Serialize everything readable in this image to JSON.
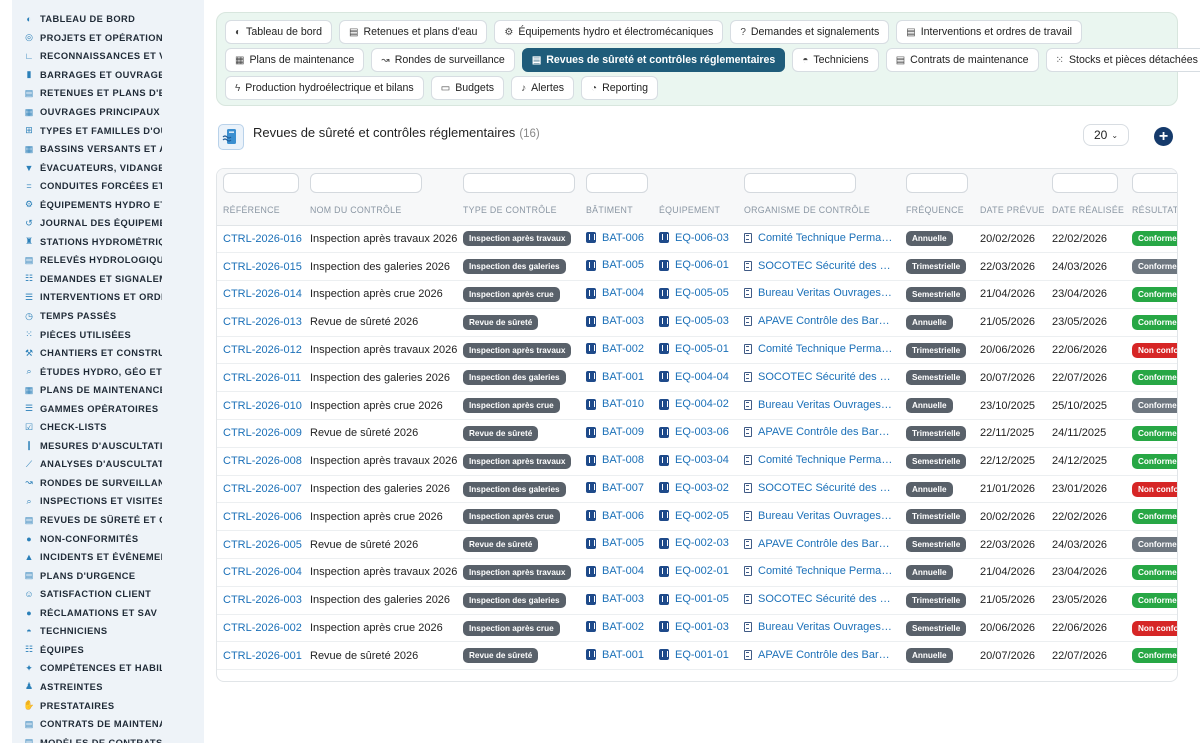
{
  "sidebar": {
    "items": [
      {
        "label": "TABLEAU DE BORD",
        "icon": "dashboard-icon",
        "glyph": "◐"
      },
      {
        "label": "PROJETS ET OPÉRATIONS",
        "icon": "target-icon",
        "glyph": "◎"
      },
      {
        "label": "RECONNAISSANCES ET VISITES",
        "icon": "ruler-icon",
        "glyph": "∟"
      },
      {
        "label": "BARRAGES ET OUVRAGES",
        "icon": "bars-icon",
        "glyph": "▮"
      },
      {
        "label": "RETENUES ET PLANS D'EAU",
        "icon": "document-icon",
        "glyph": "▤"
      },
      {
        "label": "OUVRAGES PRINCIPAUX",
        "icon": "building-icon",
        "glyph": "▦"
      },
      {
        "label": "TYPES ET FAMILLES D'OUVRAGES",
        "icon": "hierarchy-icon",
        "glyph": "⊞"
      },
      {
        "label": "BASSINS VERSANTS ET AFFLUENTS",
        "icon": "grid-icon",
        "glyph": "▦"
      },
      {
        "label": "ÉVACUATEURS, VIDANGES",
        "icon": "funnel-icon",
        "glyph": "▼"
      },
      {
        "label": "CONDUITES FORCÉES ET CANAUX",
        "icon": "pipe-icon",
        "glyph": "="
      },
      {
        "label": "ÉQUIPEMENTS HYDRO ET ÉLECTROMÉCANIQUES",
        "icon": "gears-icon",
        "glyph": "⚙"
      },
      {
        "label": "JOURNAL DES ÉQUIPEMENTS",
        "icon": "history-icon",
        "glyph": "↺"
      },
      {
        "label": "STATIONS HYDROMÉTRIQUES",
        "icon": "tower-icon",
        "glyph": "♜"
      },
      {
        "label": "RELEVÉS HYDROLOGIQUES",
        "icon": "clipboard-icon",
        "glyph": "▤"
      },
      {
        "label": "DEMANDES ET SIGNALEMENTS",
        "icon": "people-icon",
        "glyph": "☷"
      },
      {
        "label": "INTERVENTIONS ET ORDRES DE TRAVAIL",
        "icon": "list-icon",
        "glyph": "☰"
      },
      {
        "label": "TEMPS PASSÉS",
        "icon": "clock-icon",
        "glyph": "◷"
      },
      {
        "label": "PIÈCES UTILISÉES",
        "icon": "parts-icon",
        "glyph": "⁙"
      },
      {
        "label": "CHANTIERS ET CONSTRUCTIONS",
        "icon": "hammer-icon",
        "glyph": "⚒"
      },
      {
        "label": "ÉTUDES HYDRO, GÉO ET GÉNIE CIVIL",
        "icon": "search-icon",
        "glyph": "⌕"
      },
      {
        "label": "PLANS DE MAINTENANCE",
        "icon": "calendar-icon",
        "glyph": "▦"
      },
      {
        "label": "GAMMES OPÉRATOIRES",
        "icon": "list-icon",
        "glyph": "☰"
      },
      {
        "label": "CHECK-LISTS",
        "icon": "checklist-icon",
        "glyph": "☑"
      },
      {
        "label": "MESURES D'AUSCULTATION",
        "icon": "thermometer-icon",
        "glyph": "❙"
      },
      {
        "label": "ANALYSES D'AUSCULTATION",
        "icon": "chart-icon",
        "glyph": "⟋"
      },
      {
        "label": "RONDES DE SURVEILLANCE",
        "icon": "route-icon",
        "glyph": "↝"
      },
      {
        "label": "INSPECTIONS ET VISITES",
        "icon": "search-icon",
        "glyph": "⌕"
      },
      {
        "label": "REVUES DE SÛRETÉ ET CONTRÔLES",
        "icon": "clipboard-check-icon",
        "glyph": "▤"
      },
      {
        "label": "NON-CONFORMITÉS",
        "icon": "alert-circle-icon",
        "glyph": "●"
      },
      {
        "label": "INCIDENTS ET ÉVÉNEMENTS",
        "icon": "warning-icon",
        "glyph": "▲"
      },
      {
        "label": "PLANS D'URGENCE",
        "icon": "file-icon",
        "glyph": "▤"
      },
      {
        "label": "SATISFACTION CLIENT",
        "icon": "smile-icon",
        "glyph": "☺"
      },
      {
        "label": "RÉCLAMATIONS ET SAV",
        "icon": "comment-icon",
        "glyph": "●"
      },
      {
        "label": "TECHNICIENS",
        "icon": "helmet-icon",
        "glyph": "◓"
      },
      {
        "label": "ÉQUIPES",
        "icon": "team-icon",
        "glyph": "☷"
      },
      {
        "label": "COMPÉTENCES ET HABILITATIONS",
        "icon": "star-icon",
        "glyph": "✦"
      },
      {
        "label": "ASTREINTES",
        "icon": "user-icon",
        "glyph": "♟"
      },
      {
        "label": "PRESTATAIRES",
        "icon": "handshake-icon",
        "glyph": "✋"
      },
      {
        "label": "CONTRATS DE MAINTENANCE",
        "icon": "contract-icon",
        "glyph": "▤"
      },
      {
        "label": "MODÈLES DE CONTRATS",
        "icon": "template-icon",
        "glyph": "▤"
      }
    ]
  },
  "nav": {
    "rows": [
      [
        {
          "label": "Tableau de bord",
          "icon": "dashboard-icon",
          "glyph": "◐"
        },
        {
          "label": "Retenues et plans d'eau",
          "icon": "document-icon",
          "glyph": "▤"
        },
        {
          "label": "Équipements hydro et électromécaniques",
          "icon": "gears-icon",
          "glyph": "⚙"
        },
        {
          "label": "Demandes et signalements",
          "icon": "question-icon",
          "glyph": "?"
        },
        {
          "label": "Interventions et ordres de travail",
          "icon": "clipboard-icon",
          "glyph": "▤"
        }
      ],
      [
        {
          "label": "Plans de maintenance",
          "icon": "calendar-icon",
          "glyph": "▦"
        },
        {
          "label": "Rondes de surveillance",
          "icon": "route-icon",
          "glyph": "↝"
        },
        {
          "label": "Revues de sûreté et contrôles réglementaires",
          "icon": "clipboard-check-icon",
          "glyph": "▤",
          "active": true
        },
        {
          "label": "Techniciens",
          "icon": "helmet-icon",
          "glyph": "◓"
        },
        {
          "label": "Contrats de maintenance",
          "icon": "contract-icon",
          "glyph": "▤"
        },
        {
          "label": "Stocks et pièces détachées",
          "icon": "boxes-icon",
          "glyph": "⁙"
        }
      ],
      [
        {
          "label": "Production hydroélectrique et bilans",
          "icon": "bolt-icon",
          "glyph": "ϟ"
        },
        {
          "label": "Budgets",
          "icon": "money-icon",
          "glyph": "▭"
        },
        {
          "label": "Alertes",
          "icon": "bell-icon",
          "glyph": "♪"
        },
        {
          "label": "Reporting",
          "icon": "pie-icon",
          "glyph": "◔"
        }
      ]
    ]
  },
  "header": {
    "title": "Revues de sûreté et contrôles réglementaires",
    "count": "(16)",
    "page_size": "20",
    "add_label": "+"
  },
  "table": {
    "columns": [
      "RÉFÉRENCE",
      "NOM DU CONTRÔLE",
      "TYPE DE CONTRÔLE",
      "BÂTIMENT",
      "ÉQUIPEMENT",
      "ORGANISME DE CONTRÔLE",
      "FRÉQUENCE",
      "DATE PRÉVUE",
      "DATE RÉALISÉE",
      "RÉSULTAT"
    ],
    "rows": [
      {
        "ref": "CTRL-2026-016",
        "name": "Inspection après travaux 2026",
        "type": "Inspection après travaux",
        "bld": "BAT-006",
        "eq": "EQ-006-03",
        "org": "Comité Technique Permanent des Barrages",
        "freq": "Annuelle",
        "planned": "20/02/2026",
        "done": "22/02/2026",
        "result": "Conforme",
        "result_kind": "green"
      },
      {
        "ref": "CTRL-2026-015",
        "name": "Inspection des galeries 2026",
        "type": "Inspection des galeries",
        "bld": "BAT-005",
        "eq": "EQ-006-01",
        "org": "SOCOTEC Sécurité des Barrages",
        "freq": "Trimestrielle",
        "planned": "22/03/2026",
        "done": "24/03/2026",
        "result": "Conforme",
        "result_kind": "grey"
      },
      {
        "ref": "CTRL-2026-014",
        "name": "Inspection après crue 2026",
        "type": "Inspection après crue",
        "bld": "BAT-004",
        "eq": "EQ-005-05",
        "org": "Bureau Veritas Ouvrages Hydrauliques",
        "freq": "Semestrielle",
        "planned": "21/04/2026",
        "done": "23/04/2026",
        "result": "Conforme",
        "result_kind": "green"
      },
      {
        "ref": "CTRL-2026-013",
        "name": "Revue de sûreté 2026",
        "type": "Revue de sûreté",
        "bld": "BAT-003",
        "eq": "EQ-005-03",
        "org": "APAVE Contrôle des Barrages",
        "freq": "Annuelle",
        "planned": "21/05/2026",
        "done": "23/05/2026",
        "result": "Conforme",
        "result_kind": "green"
      },
      {
        "ref": "CTRL-2026-012",
        "name": "Inspection après travaux 2026",
        "type": "Inspection après travaux",
        "bld": "BAT-002",
        "eq": "EQ-005-01",
        "org": "Comité Technique Permanent des Barrages",
        "freq": "Trimestrielle",
        "planned": "20/06/2026",
        "done": "22/06/2026",
        "result": "Non conforme",
        "result_kind": "red"
      },
      {
        "ref": "CTRL-2026-011",
        "name": "Inspection des galeries 2026",
        "type": "Inspection des galeries",
        "bld": "BAT-001",
        "eq": "EQ-004-04",
        "org": "SOCOTEC Sécurité des Barrages",
        "freq": "Semestrielle",
        "planned": "20/07/2026",
        "done": "22/07/2026",
        "result": "Conforme",
        "result_kind": "green"
      },
      {
        "ref": "CTRL-2026-010",
        "name": "Inspection après crue 2026",
        "type": "Inspection après crue",
        "bld": "BAT-010",
        "eq": "EQ-004-02",
        "org": "Bureau Veritas Ouvrages Hydrauliques",
        "freq": "Annuelle",
        "planned": "23/10/2025",
        "done": "25/10/2025",
        "result": "Conforme",
        "result_kind": "grey"
      },
      {
        "ref": "CTRL-2026-009",
        "name": "Revue de sûreté 2026",
        "type": "Revue de sûreté",
        "bld": "BAT-009",
        "eq": "EQ-003-06",
        "org": "APAVE Contrôle des Barrages",
        "freq": "Trimestrielle",
        "planned": "22/11/2025",
        "done": "24/11/2025",
        "result": "Conforme",
        "result_kind": "green"
      },
      {
        "ref": "CTRL-2026-008",
        "name": "Inspection après travaux 2026",
        "type": "Inspection après travaux",
        "bld": "BAT-008",
        "eq": "EQ-003-04",
        "org": "Comité Technique Permanent des Barrages",
        "freq": "Semestrielle",
        "planned": "22/12/2025",
        "done": "24/12/2025",
        "result": "Conforme",
        "result_kind": "green"
      },
      {
        "ref": "CTRL-2026-007",
        "name": "Inspection des galeries 2026",
        "type": "Inspection des galeries",
        "bld": "BAT-007",
        "eq": "EQ-003-02",
        "org": "SOCOTEC Sécurité des Barrages",
        "freq": "Annuelle",
        "planned": "21/01/2026",
        "done": "23/01/2026",
        "result": "Non conforme",
        "result_kind": "red"
      },
      {
        "ref": "CTRL-2026-006",
        "name": "Inspection après crue 2026",
        "type": "Inspection après crue",
        "bld": "BAT-006",
        "eq": "EQ-002-05",
        "org": "Bureau Veritas Ouvrages Hydrauliques",
        "freq": "Trimestrielle",
        "planned": "20/02/2026",
        "done": "22/02/2026",
        "result": "Conforme",
        "result_kind": "green"
      },
      {
        "ref": "CTRL-2026-005",
        "name": "Revue de sûreté 2026",
        "type": "Revue de sûreté",
        "bld": "BAT-005",
        "eq": "EQ-002-03",
        "org": "APAVE Contrôle des Barrages",
        "freq": "Semestrielle",
        "planned": "22/03/2026",
        "done": "24/03/2026",
        "result": "Conforme",
        "result_kind": "grey"
      },
      {
        "ref": "CTRL-2026-004",
        "name": "Inspection après travaux 2026",
        "type": "Inspection après travaux",
        "bld": "BAT-004",
        "eq": "EQ-002-01",
        "org": "Comité Technique Permanent des Barrages",
        "freq": "Annuelle",
        "planned": "21/04/2026",
        "done": "23/04/2026",
        "result": "Conforme",
        "result_kind": "green"
      },
      {
        "ref": "CTRL-2026-003",
        "name": "Inspection des galeries 2026",
        "type": "Inspection des galeries",
        "bld": "BAT-003",
        "eq": "EQ-001-05",
        "org": "SOCOTEC Sécurité des Barrages",
        "freq": "Trimestrielle",
        "planned": "21/05/2026",
        "done": "23/05/2026",
        "result": "Conforme",
        "result_kind": "green"
      },
      {
        "ref": "CTRL-2026-002",
        "name": "Inspection après crue 2026",
        "type": "Inspection après crue",
        "bld": "BAT-002",
        "eq": "EQ-001-03",
        "org": "Bureau Veritas Ouvrages Hydrauliques",
        "freq": "Semestrielle",
        "planned": "20/06/2026",
        "done": "22/06/2026",
        "result": "Non conforme",
        "result_kind": "red"
      },
      {
        "ref": "CTRL-2026-001",
        "name": "Revue de sûreté 2026",
        "type": "Revue de sûreté",
        "bld": "BAT-001",
        "eq": "EQ-001-01",
        "org": "APAVE Contrôle des Barrages",
        "freq": "Annuelle",
        "planned": "20/07/2026",
        "done": "22/07/2026",
        "result": "Conforme",
        "result_kind": "green"
      }
    ]
  },
  "colors": {
    "accent": "#1f5c7a",
    "link": "#1b70b8",
    "ok": "#27a745",
    "ko": "#d62626",
    "panel": "#eaf6f0"
  }
}
